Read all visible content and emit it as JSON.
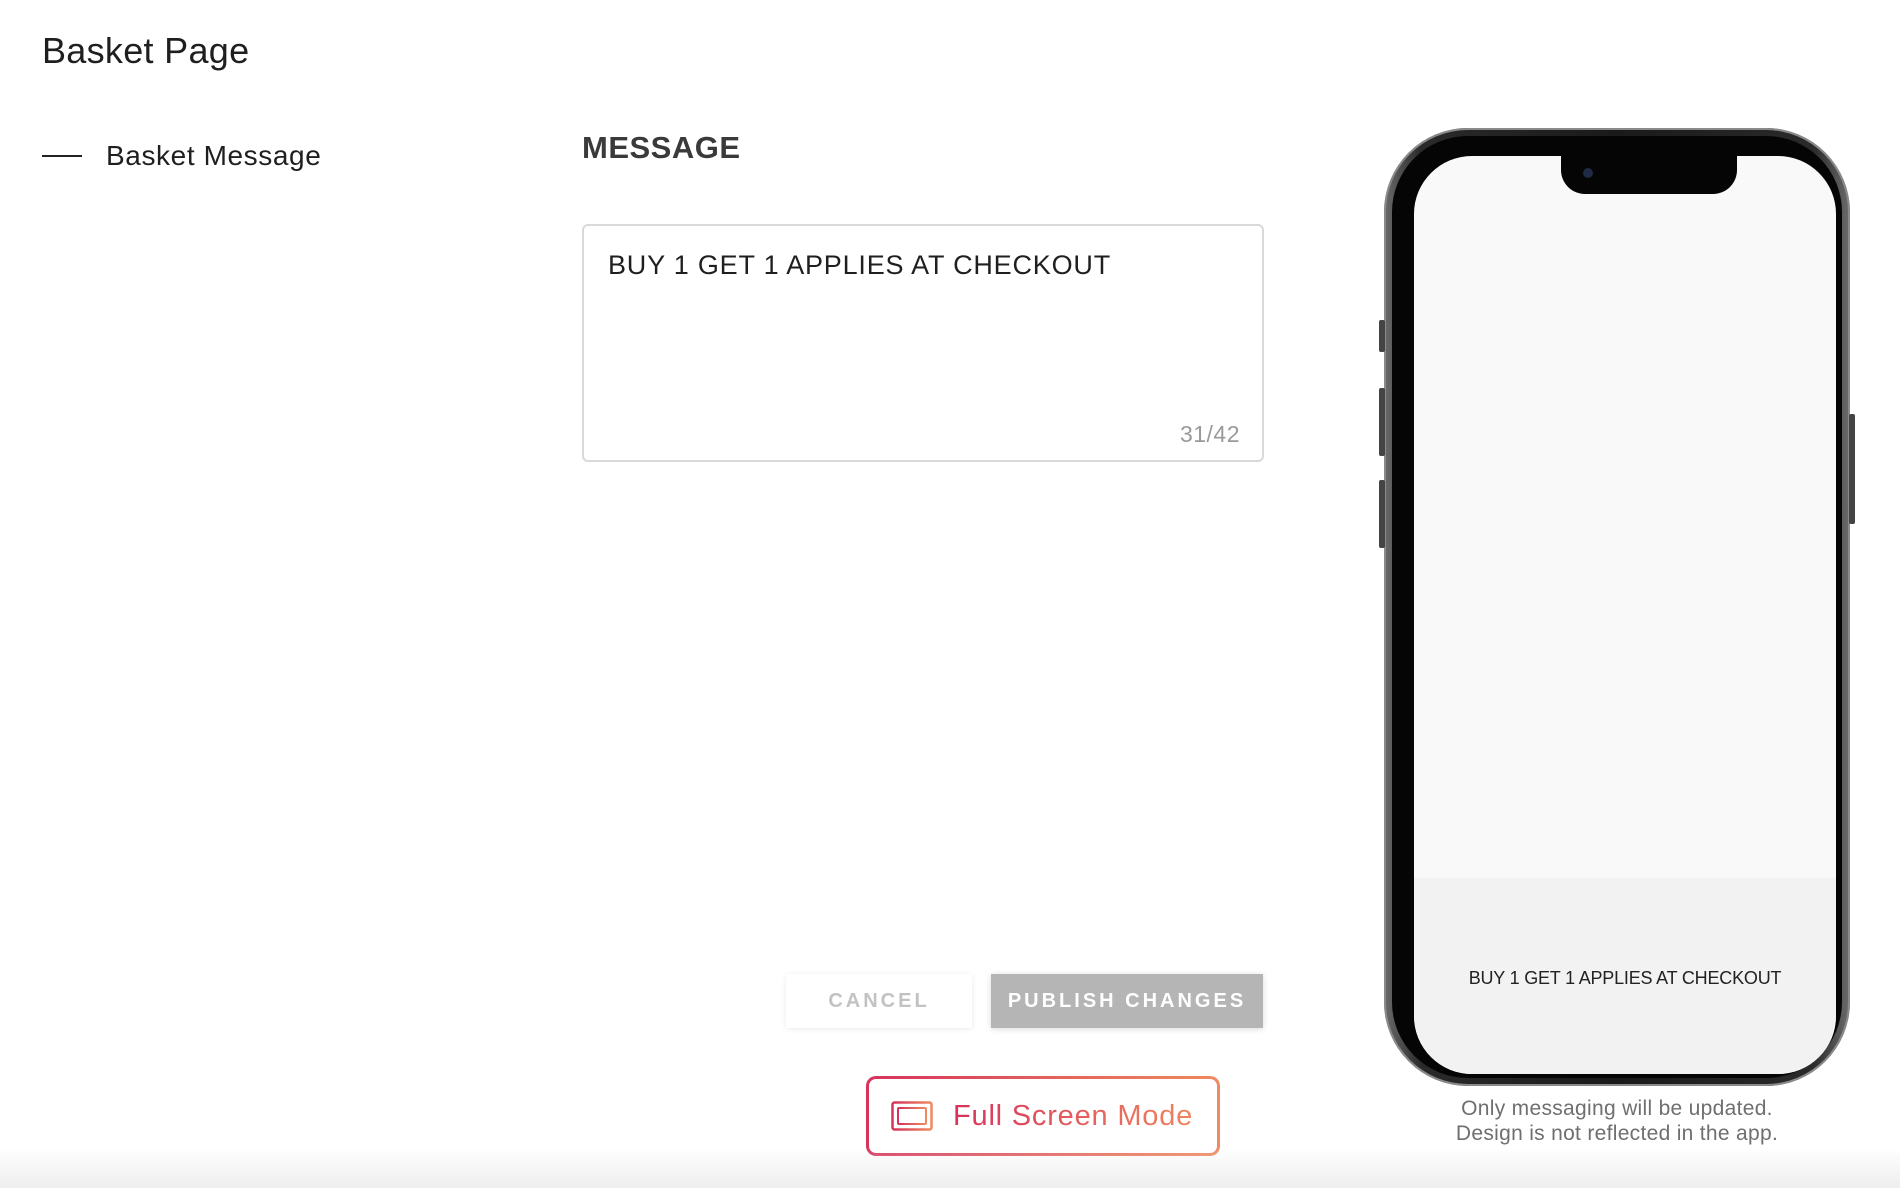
{
  "page": {
    "title": "Basket Page"
  },
  "sidebar": {
    "items": [
      {
        "label": "Basket Message"
      }
    ]
  },
  "editor": {
    "heading": "MESSAGE",
    "message_value": "BUY 1 GET 1 APPLIES AT CHECKOUT",
    "char_counter": "31/42"
  },
  "actions": {
    "cancel_label": "CANCEL",
    "publish_label": "PUBLISH CHANGES",
    "fullscreen_label": "Full Screen Mode",
    "fullscreen_icon": "screen-frame-icon"
  },
  "preview": {
    "banner_text": "BUY 1 GET 1 APPLIES AT CHECKOUT",
    "note_line1": "Only messaging will be updated.",
    "note_line2": "Design is not reflected in the app."
  },
  "colors": {
    "accent_gradient_start": "#d6335c",
    "accent_gradient_end": "#ef8a5e",
    "publish_disabled": "#b5b5b5"
  }
}
